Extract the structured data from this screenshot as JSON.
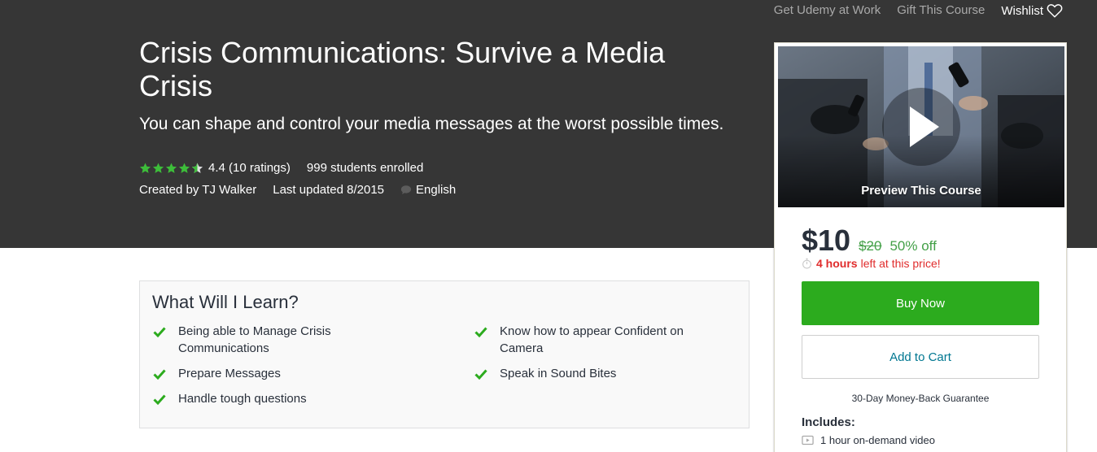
{
  "topnav": {
    "business": "Get Udemy at Work",
    "gift": "Gift This Course",
    "wishlist": "Wishlist"
  },
  "course": {
    "title": "Crisis Communications: Survive a Media Crisis",
    "subtitle": "You can shape and control your media messages at the worst possible times.",
    "rating_value": 4.4,
    "rating_text": "4.4 (10 ratings)",
    "enrolled": "999 students enrolled",
    "created_by_label": "Created by",
    "instructor": "TJ Walker",
    "last_updated": "Last updated 8/2015",
    "language": "English"
  },
  "sidebar": {
    "preview_label": "Preview This Course",
    "price": "$10",
    "original_price": "$20",
    "discount": "50% off",
    "timer_hours": "4 hours",
    "timer_suffix": "left at this price!",
    "buy_now": "Buy Now",
    "add_to_cart": "Add to Cart",
    "guarantee": "30-Day Money-Back Guarantee",
    "includes_heading": "Includes:",
    "includes": [
      "1 hour on-demand video"
    ]
  },
  "learn": {
    "heading": "What Will I Learn?",
    "items": [
      "Being able to Manage Crisis Communications",
      "Know how to appear Confident on Camera",
      "Prepare Messages",
      "Speak in Sound Bites",
      "Handle tough questions"
    ]
  },
  "colors": {
    "hero_bg": "#363636",
    "accent_green": "#2cab1e",
    "price_green": "#43a047",
    "timer_red": "#e02c2c",
    "link_blue": "#007791",
    "star_green": "#3dbd3a"
  },
  "icons": {
    "wishlist": "heart-outline-icon",
    "language": "speech-bubble-icon",
    "timer": "stopwatch-icon",
    "play": "play-icon",
    "check": "checkmark-icon",
    "video": "video-icon",
    "star": "star-icon"
  }
}
